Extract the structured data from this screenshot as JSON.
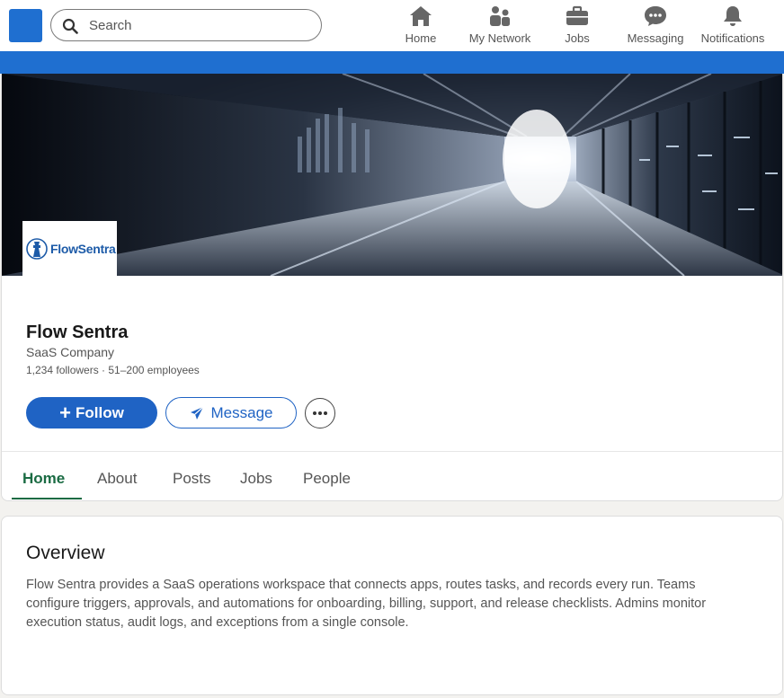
{
  "search": {
    "placeholder": "Search"
  },
  "nav": {
    "items": [
      {
        "label": "Home",
        "icon": "home-icon"
      },
      {
        "label": "My Network",
        "icon": "network-icon"
      },
      {
        "label": "Jobs",
        "icon": "briefcase-icon"
      },
      {
        "label": "Messaging",
        "icon": "messaging-icon"
      },
      {
        "label": "Notifications",
        "icon": "bell-icon"
      }
    ]
  },
  "company": {
    "logo_text": "FlowSentra",
    "name": "Flow Sentra",
    "type": "SaaS Company",
    "meta": "1,234 followers · 51–200 employees"
  },
  "actions": {
    "follow_plus": "+",
    "follow_label": "Follow",
    "message_label": "Message",
    "more_icon": "more-icon"
  },
  "tabs": [
    {
      "label": "Home",
      "active": true
    },
    {
      "label": "About",
      "active": false
    },
    {
      "label": "Posts",
      "active": false
    },
    {
      "label": "Jobs",
      "active": false
    },
    {
      "label": "People",
      "active": false
    }
  ],
  "overview": {
    "title": "Overview",
    "text": "Flow Sentra provides a SaaS operations workspace that connects apps, routes tasks, and records every run. Teams configure triggers, approvals, and automations for onboarding, billing, support, and release checklists. Admins monitor execution status, audit logs, and exceptions from a single console."
  },
  "colors": {
    "brand_blue": "#1f6fd0",
    "follow_blue": "#1f63c4",
    "active_tab_green": "#1a6b43"
  }
}
